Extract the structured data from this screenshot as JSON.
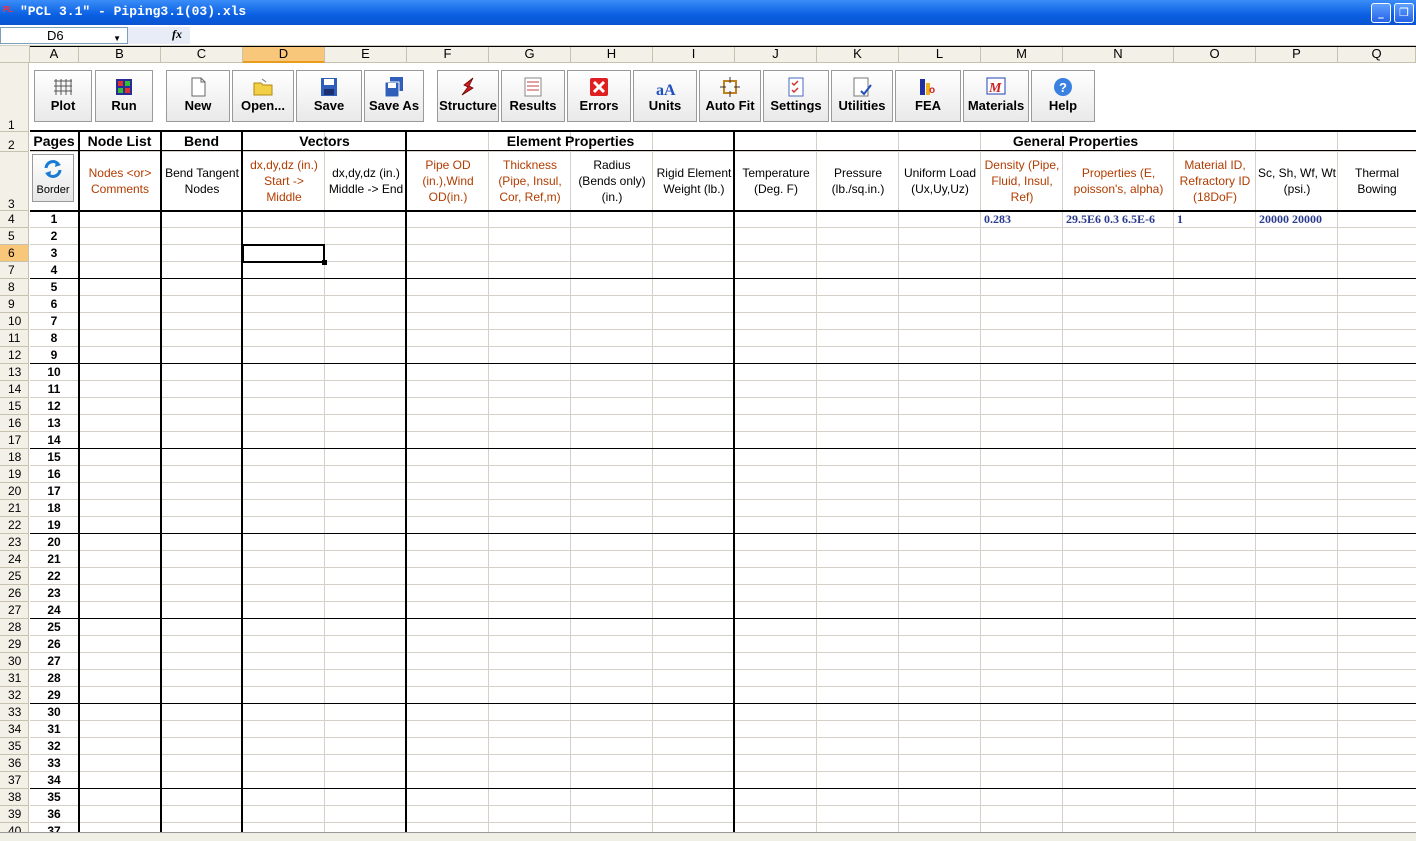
{
  "window": {
    "title": "\"PCL 3.1\" - Piping3.1(03).xls"
  },
  "formula_bar": {
    "name_box": "D6",
    "fx": "fx"
  },
  "columns": [
    "A",
    "B",
    "C",
    "D",
    "E",
    "F",
    "G",
    "H",
    "I",
    "J",
    "K",
    "L",
    "M",
    "N",
    "O",
    "P",
    "Q"
  ],
  "selected_column": "D",
  "row_numbers": [
    1,
    2,
    3,
    4,
    5,
    6,
    7,
    8,
    9,
    10,
    11,
    12,
    13,
    14,
    15,
    16,
    17,
    18,
    19,
    20,
    21,
    22,
    23,
    24,
    25,
    26,
    27,
    28,
    29,
    30,
    31,
    32,
    33,
    34,
    35,
    36,
    37,
    38,
    39,
    40
  ],
  "selected_row": 6,
  "toolbar": [
    {
      "id": "plot",
      "label": "Plot",
      "icon": "grid-icon"
    },
    {
      "id": "run",
      "label": "Run",
      "icon": "run-icon"
    },
    {
      "id": "new",
      "label": "New",
      "icon": "new-document-icon"
    },
    {
      "id": "open",
      "label": "Open...",
      "icon": "folder-icon"
    },
    {
      "id": "save",
      "label": "Save",
      "icon": "floppy-icon"
    },
    {
      "id": "saveas",
      "label": "Save As",
      "icon": "floppy-multi-icon"
    },
    {
      "id": "structure",
      "label": "Structure",
      "icon": "structure-icon"
    },
    {
      "id": "results",
      "label": "Results",
      "icon": "results-icon"
    },
    {
      "id": "errors",
      "label": "Errors",
      "icon": "error-x-icon"
    },
    {
      "id": "units",
      "label": "Units",
      "icon": "units-icon"
    },
    {
      "id": "autofit",
      "label": "Auto Fit",
      "icon": "autofit-icon"
    },
    {
      "id": "settings",
      "label": "Settings",
      "icon": "checklist-icon"
    },
    {
      "id": "utilities",
      "label": "Utilities",
      "icon": "utilities-icon"
    },
    {
      "id": "fea",
      "label": "FEA",
      "icon": "fea-icon"
    },
    {
      "id": "materials",
      "label": "Materials",
      "icon": "materials-icon"
    },
    {
      "id": "help",
      "label": "Help",
      "icon": "help-icon"
    }
  ],
  "sections": {
    "pages": "Pages",
    "node_list": "Node List",
    "bend": "Bend",
    "vectors": "Vectors",
    "element_properties": "Element Properties",
    "general_properties": "General Properties"
  },
  "border_button": "Border",
  "headers": {
    "B": "Nodes <or> Comments",
    "C": "Bend Tangent Nodes",
    "D": "dx,dy,dz (in.) Start -> Middle",
    "E": "dx,dy,dz (in.) Middle -> End",
    "F": "Pipe OD (in.),Wind OD(in.)",
    "G": "Thickness (Pipe, Insul, Cor, Ref,m)",
    "H": "Radius (Bends only) (in.)",
    "I": "Rigid Element Weight (lb.)",
    "J": "Temperature (Deg. F)",
    "K": "Pressure (lb./sq.in.)",
    "L": "Uniform Load (Ux,Uy,Uz)",
    "M": "Density (Pipe, Fluid, Insul, Ref)",
    "N": "Properties (E, poisson's, alpha)",
    "O": "Material ID, Refractory ID (18DoF)",
    "P": "Sc, Sh, Wf, Wt (psi.)",
    "Q": "Thermal Bowing"
  },
  "page_numbers": [
    1,
    2,
    3,
    4,
    5,
    6,
    7,
    8,
    9,
    10,
    11,
    12,
    13,
    14,
    15,
    16,
    17,
    18,
    19,
    20,
    21,
    22,
    23,
    24,
    25,
    26,
    27,
    28,
    29,
    30,
    31,
    32,
    33,
    34,
    35,
    36,
    37
  ],
  "row4_values": {
    "M": "0.283",
    "N": "29.5E6 0.3 6.5E-6",
    "O": "1",
    "P": "20000 20000"
  }
}
